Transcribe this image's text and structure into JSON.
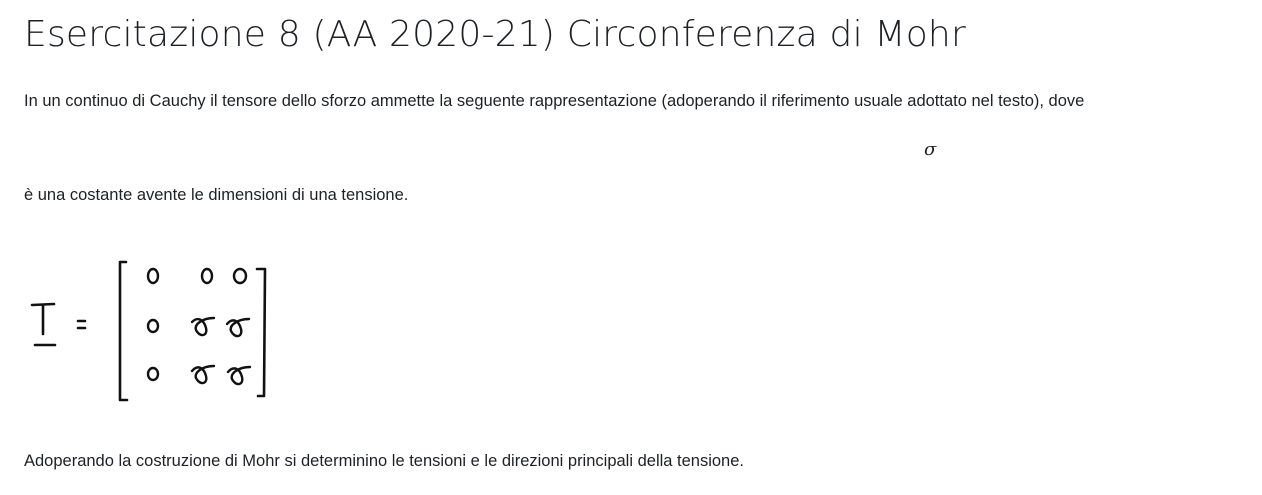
{
  "page": {
    "title": "Esercitazione 8 (AA 2020-21) Circonferenza di Mohr",
    "paragraph_1": "In un continuo di Cauchy il tensore dello sforzo ammette la seguente rappresentazione (adoperando il riferimento usuale adottato nel testo), dove",
    "sigma_symbol": "σ",
    "paragraph_2": "è una costante avente le dimensioni di una tensione.",
    "paragraph_3": "Adoperando la costruzione di Mohr si determinino le tensioni e le direzioni principali della tensione."
  },
  "matrix": {
    "label": "T",
    "equals": "=",
    "rows": [
      [
        "0",
        "0",
        "0"
      ],
      [
        "0",
        "σ",
        "σ"
      ],
      [
        "0",
        "σ",
        "σ"
      ]
    ]
  }
}
